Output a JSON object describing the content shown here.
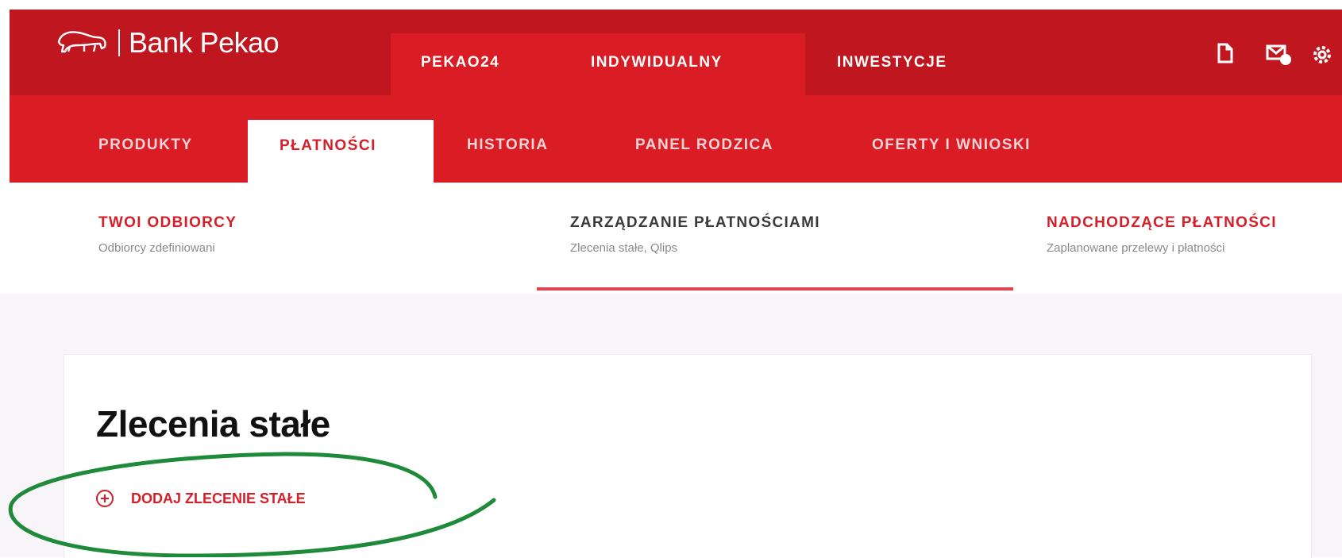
{
  "brand": {
    "name": "Bank Pekao",
    "primary_color": "#da1c24",
    "dark_color": "#bf161f"
  },
  "segments": [
    {
      "label": "PEKAO24"
    },
    {
      "label": "INDYWIDUALNY",
      "active": true
    },
    {
      "label": "INWESTYCJE"
    }
  ],
  "top_icons": [
    "document-icon",
    "message-icon",
    "settings-icon"
  ],
  "subnav": [
    {
      "label": "PRODUKTY"
    },
    {
      "label": "PŁATNOŚCI",
      "active": true
    },
    {
      "label": "HISTORIA"
    },
    {
      "label": "PANEL RODZICA"
    },
    {
      "label": "OFERTY I WNIOSKI"
    }
  ],
  "sections": [
    {
      "title": "TWOI ODBIORCY",
      "subtitle": "Odbiorcy zdefiniowani"
    },
    {
      "title": "ZARZĄDZANIE PŁATNOŚCIAMI",
      "subtitle": "Zlecenia stałe, Qlips",
      "active": true
    },
    {
      "title": "NADCHODZĄCE PŁATNOŚCI",
      "subtitle": "Zaplanowane przelewy i płatności"
    }
  ],
  "main": {
    "title": "Zlecenia stałe",
    "add_link": "DODAJ ZLECENIE STAŁE"
  },
  "annotation": {
    "shape": "hand-drawn ellipse",
    "color": "#1f8a3a"
  }
}
